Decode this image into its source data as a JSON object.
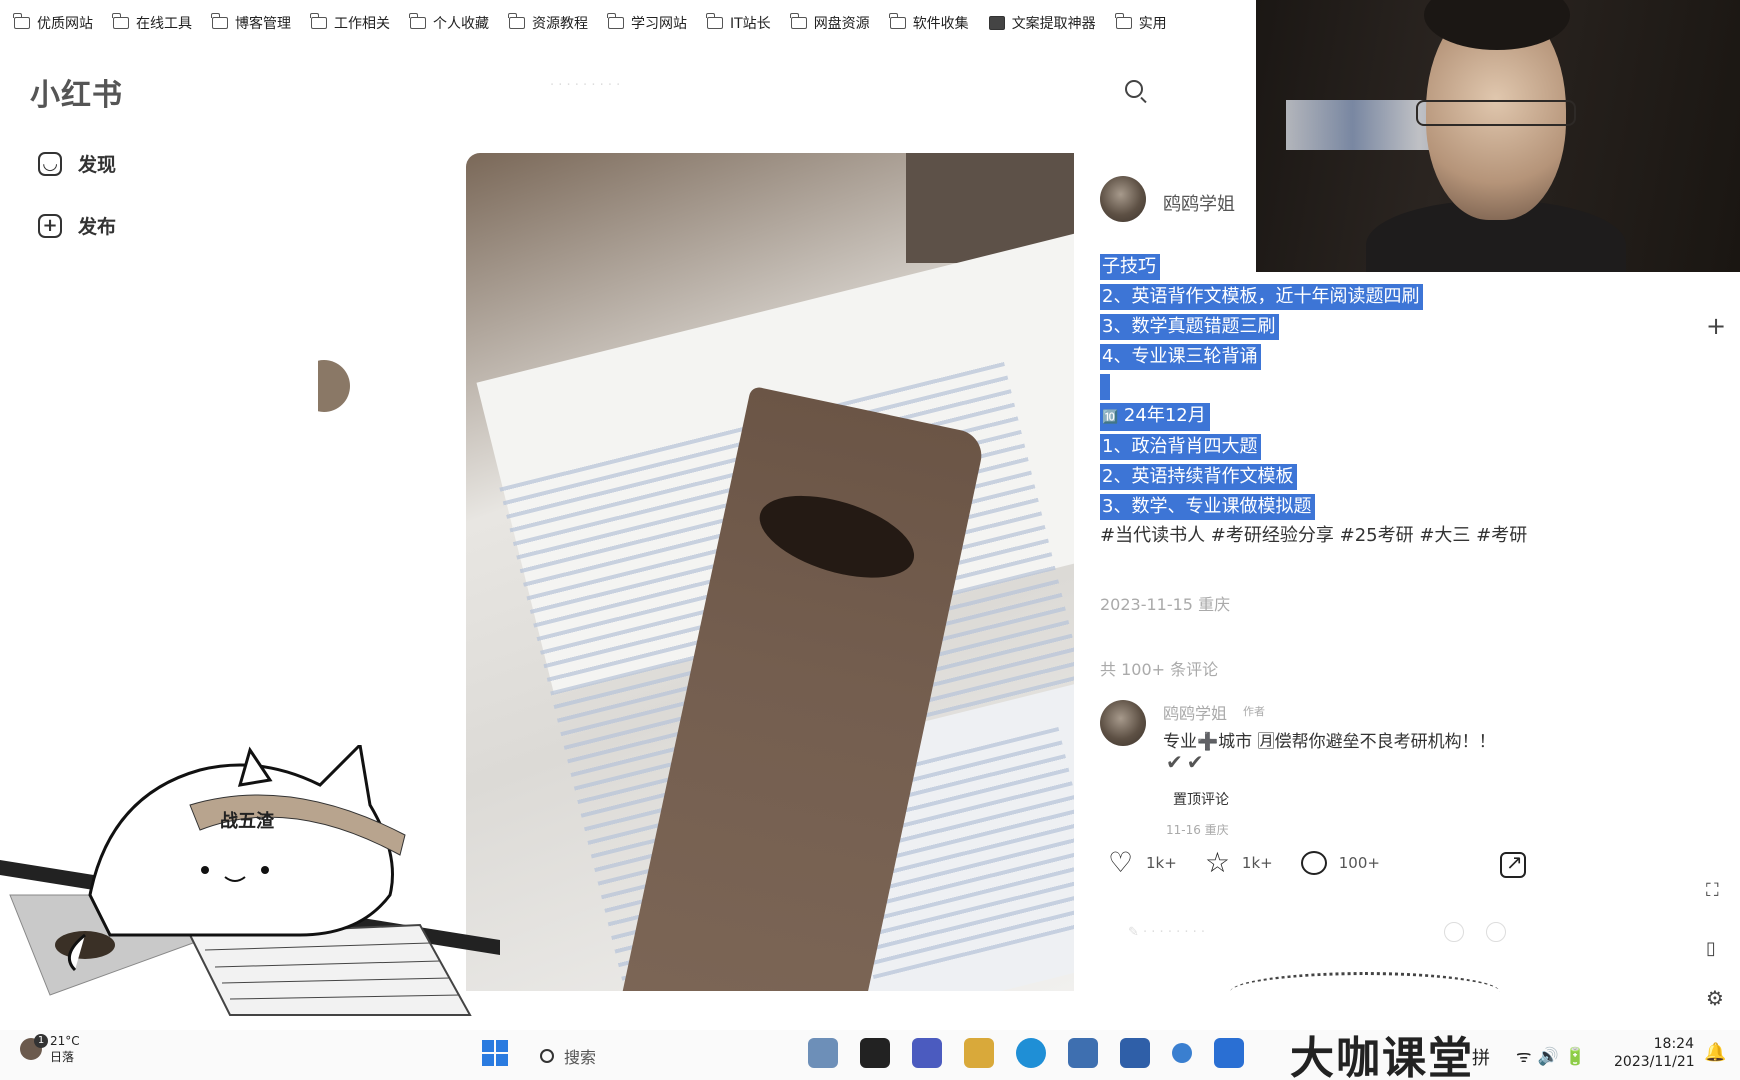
{
  "bookmarks": [
    {
      "label": "优质网站",
      "icon": "folder-icon"
    },
    {
      "label": "在线工具",
      "icon": "folder-icon"
    },
    {
      "label": "博客管理",
      "icon": "folder-icon"
    },
    {
      "label": "工作相关",
      "icon": "folder-icon"
    },
    {
      "label": "个人收藏",
      "icon": "folder-icon"
    },
    {
      "label": "资源教程",
      "icon": "folder-icon"
    },
    {
      "label": "学习网站",
      "icon": "folder-icon"
    },
    {
      "label": "IT站长",
      "icon": "folder-icon"
    },
    {
      "label": "网盘资源",
      "icon": "folder-icon"
    },
    {
      "label": "软件收集",
      "icon": "folder-icon"
    },
    {
      "label": "文案提取神器",
      "icon": "tool-icon"
    },
    {
      "label": "实用",
      "icon": "folder-icon"
    }
  ],
  "app": {
    "logo": "小红书"
  },
  "nav": {
    "discover": "发现",
    "publish": "发布"
  },
  "post": {
    "author": "鸥鸥学姐",
    "highlighted_lines": [
      "子技巧",
      "2、英语背作文模板，近十年阅读题四刷",
      "3、数学真题错题三刷",
      "4、专业课三轮背诵",
      "",
      "24年12月",
      "1、政治背肖四大题",
      "2、英语持续背作文模板",
      "3、数学、专业课做模拟题"
    ],
    "badge_emoji": "🔟",
    "tags": "#当代读书人 #考研经验分享 #25考研 #大三 #考研",
    "date_location": "2023-11-15 重庆",
    "comment_count": "共 100+ 条评论"
  },
  "comment": {
    "author": "鸥鸥学姐",
    "badge": "作者",
    "text": "专业➕城市 🈷偿帮你避垒不良考研机构！！",
    "checks": "✔✔",
    "pinned": "置顶评论",
    "time": "11-16 重庆"
  },
  "actions": {
    "likes": "1k+",
    "collects": "1k+",
    "comments": "100+"
  },
  "taskbar": {
    "temperature": "21°C",
    "weather_status": "日落",
    "weather_badge": "1",
    "search_label": "搜索",
    "brand": "大咖课堂",
    "ime": "拼",
    "time": "18:24",
    "date": "2023/11/21"
  },
  "colors": {
    "highlight": "#3d75d6",
    "windows_blue": "#2a7be0"
  }
}
